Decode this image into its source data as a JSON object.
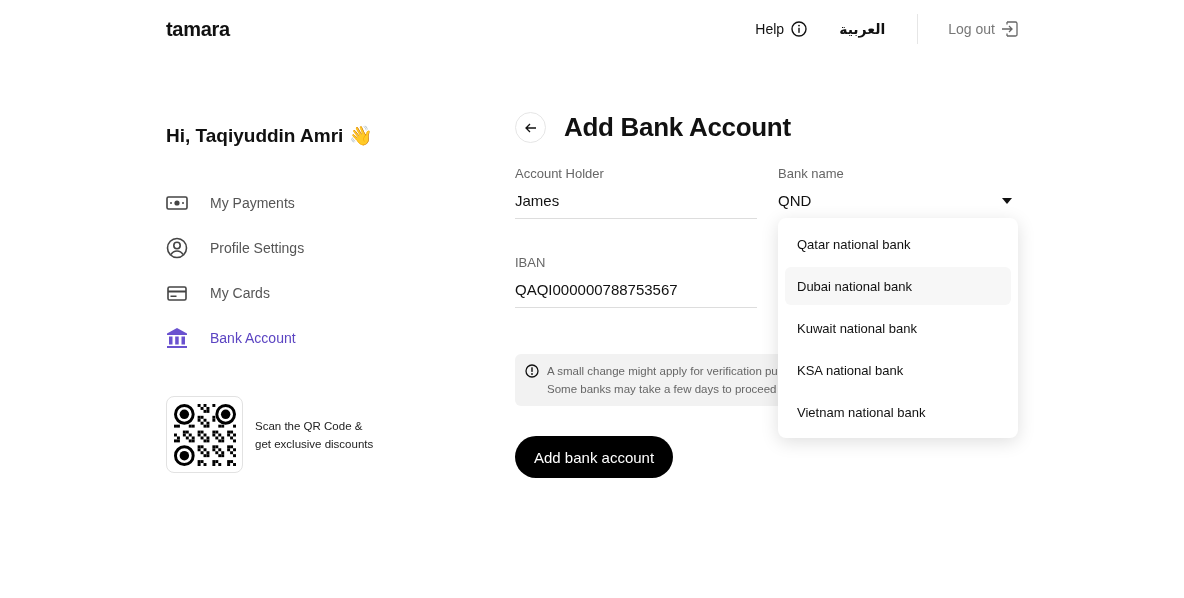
{
  "header": {
    "logo": "tamara",
    "help": "Help",
    "language": "العربية",
    "logout": "Log out"
  },
  "greeting": "Hi, Taqiyuddin Amri 👋",
  "sidebar": {
    "items": [
      {
        "label": "My Payments",
        "selected": false
      },
      {
        "label": "Profile Settings",
        "selected": false
      },
      {
        "label": "My Cards",
        "selected": false
      },
      {
        "label": "Bank Account",
        "selected": true
      }
    ]
  },
  "promo": {
    "line_1": "Scan the QR Code &",
    "line_2": "get exclusive discounts"
  },
  "page_title": "Add Bank Account",
  "form": {
    "account_holder": {
      "label": "Account Holder",
      "value": "James"
    },
    "bank_name": {
      "label": "Bank name",
      "value": "QND",
      "expanded": true,
      "options": [
        {
          "label": "Qatar national bank",
          "selected": false
        },
        {
          "label": "Dubai national bank",
          "selected": true
        },
        {
          "label": "Kuwait national bank",
          "selected": false
        },
        {
          "label": "KSA national bank",
          "selected": false
        },
        {
          "label": "Vietnam national bank",
          "selected": false
        }
      ]
    },
    "iban": {
      "label": "IBAN",
      "value": "QAQI000000788753567"
    }
  },
  "notice": {
    "line_1": "A small change might apply for verification pu",
    "line_2": "Some banks may take a few days to proceed"
  },
  "submit": "Add bank account"
}
